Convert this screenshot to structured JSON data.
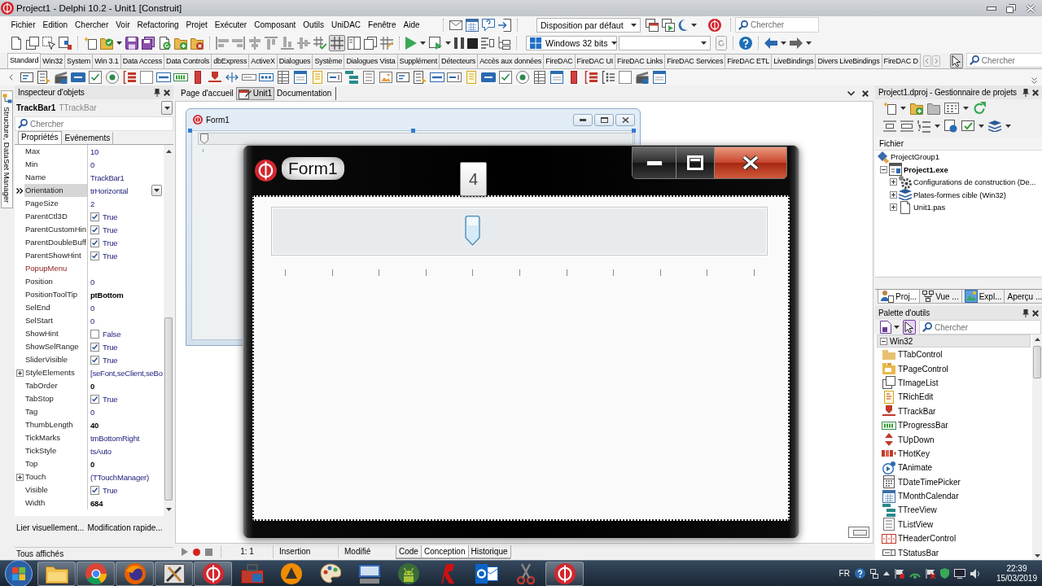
{
  "title_bar": {
    "title": "Project1 - Delphi 10.2 - Unit1 [Construit]"
  },
  "menu_bar": {
    "items": [
      "Fichier",
      "Edition",
      "Chercher",
      "Voir",
      "Refactoring",
      "Projet",
      "Exécuter",
      "Composant",
      "Outils",
      "UniDAC",
      "Fenêtre",
      "Aide"
    ],
    "layout": {
      "value": "Disposition par défaut"
    },
    "search": {
      "placeholder": "Chercher"
    }
  },
  "toolbar": {
    "grid_button": {
      "on": true
    },
    "platform": {
      "value": "Windows 32 bits"
    }
  },
  "component_palette": {
    "tabs": [
      {
        "label": "Standard",
        "selected": true
      },
      {
        "label": "Win32",
        "selected": false
      },
      {
        "label": "System",
        "selected": false
      },
      {
        "label": "Win 3.1",
        "selected": false
      },
      {
        "label": "Data Access",
        "selected": false
      },
      {
        "label": "Data Controls",
        "selected": false
      },
      {
        "label": "dbExpress",
        "selected": false
      },
      {
        "label": "ActiveX",
        "selected": false
      },
      {
        "label": "Dialogues",
        "selected": false
      },
      {
        "label": "Système",
        "selected": false
      },
      {
        "label": "Dialogues Vista",
        "selected": false
      },
      {
        "label": "Supplément",
        "selected": false
      },
      {
        "label": "Détecteurs",
        "selected": false
      },
      {
        "label": "Accès aux données",
        "selected": false
      },
      {
        "label": "FireDAC",
        "selected": false
      },
      {
        "label": "FireDAC UI",
        "selected": false
      },
      {
        "label": "FireDAC Links",
        "selected": false
      },
      {
        "label": "FireDAC Services",
        "selected": false
      },
      {
        "label": "FireDAC ETL",
        "selected": false
      },
      {
        "label": "LiveBindings",
        "selected": false
      },
      {
        "label": "Divers LiveBindings",
        "selected": false
      },
      {
        "label": "FireDAC D",
        "selected": false
      }
    ],
    "pointer_button": {
      "on": true
    },
    "search": {
      "placeholder": "Chercher"
    }
  },
  "side_tab": {
    "label": "Structure, DataSet Manager"
  },
  "object_inspector": {
    "title": "Inspecteur d'objets",
    "component": {
      "name": "TrackBar1",
      "type": "TTrackBar"
    },
    "search": {
      "placeholder": "Chercher"
    },
    "tabs": [
      {
        "label": "Propriétés",
        "selected": true
      },
      {
        "label": "Evénements",
        "selected": false
      }
    ],
    "properties": [
      {
        "name": "Max",
        "value": "10",
        "kind": "text",
        "selected": false,
        "non_default": false
      },
      {
        "name": "Min",
        "value": "0",
        "kind": "text",
        "selected": false,
        "non_default": false
      },
      {
        "name": "Name",
        "value": "TrackBar1",
        "kind": "text",
        "selected": false,
        "non_default": false
      },
      {
        "name": "Orientation",
        "value": "trHorizontal",
        "kind": "text",
        "selected": true,
        "non_default": false
      },
      {
        "name": "PageSize",
        "value": "2",
        "kind": "text",
        "selected": false,
        "non_default": false
      },
      {
        "name": "ParentCtl3D",
        "value": "True",
        "kind": "check",
        "checked": true,
        "selected": false,
        "non_default": false
      },
      {
        "name": "ParentCustomHin",
        "value": "True",
        "kind": "check",
        "checked": true,
        "selected": false,
        "non_default": false
      },
      {
        "name": "ParentDoubleBuff",
        "value": "True",
        "kind": "check",
        "checked": true,
        "selected": false,
        "non_default": false
      },
      {
        "name": "ParentShowHint",
        "value": "True",
        "kind": "check",
        "checked": true,
        "selected": false,
        "non_default": false
      },
      {
        "name": "PopupMenu",
        "kind": "link",
        "selected": false
      },
      {
        "name": "Position",
        "value": "0",
        "kind": "text",
        "selected": false,
        "non_default": false
      },
      {
        "name": "PositionToolTip",
        "value": "ptBottom",
        "kind": "text",
        "selected": false,
        "non_default": true
      },
      {
        "name": "SelEnd",
        "value": "0",
        "kind": "text",
        "selected": false,
        "non_default": false
      },
      {
        "name": "SelStart",
        "value": "0",
        "kind": "text",
        "selected": false,
        "non_default": false
      },
      {
        "name": "ShowHint",
        "value": "False",
        "kind": "check",
        "checked": false,
        "selected": false,
        "non_default": false
      },
      {
        "name": "ShowSelRange",
        "value": "True",
        "kind": "check",
        "checked": true,
        "selected": false,
        "non_default": false
      },
      {
        "name": "SliderVisible",
        "value": "True",
        "kind": "check",
        "checked": true,
        "selected": false,
        "non_default": false
      },
      {
        "name": "StyleElements",
        "value": "[seFont,seClient,seBo",
        "kind": "group",
        "expanded": false,
        "selected": false,
        "non_default": false
      },
      {
        "name": "TabOrder",
        "value": "0",
        "kind": "text",
        "selected": false,
        "non_default": true
      },
      {
        "name": "TabStop",
        "value": "True",
        "kind": "check",
        "checked": true,
        "selected": false,
        "non_default": false
      },
      {
        "name": "Tag",
        "value": "0",
        "kind": "text",
        "selected": false,
        "non_default": false
      },
      {
        "name": "ThumbLength",
        "value": "40",
        "kind": "text",
        "selected": false,
        "non_default": true
      },
      {
        "name": "TickMarks",
        "value": "tmBottomRight",
        "kind": "text",
        "selected": false,
        "non_default": false
      },
      {
        "name": "TickStyle",
        "value": "tsAuto",
        "kind": "text",
        "selected": false,
        "non_default": false
      },
      {
        "name": "Top",
        "value": "0",
        "kind": "text",
        "selected": false,
        "non_default": true
      },
      {
        "name": "Touch",
        "value": "(TTouchManager)",
        "kind": "group",
        "expanded": false,
        "selected": false,
        "non_default": false
      },
      {
        "name": "Visible",
        "value": "True",
        "kind": "check",
        "checked": true,
        "selected": false,
        "non_default": false
      },
      {
        "name": "Width",
        "value": "684",
        "kind": "text",
        "selected": false,
        "non_default": true
      }
    ],
    "links": [
      "Lier visuellement...",
      "Modification rapide..."
    ],
    "filter": "Tous affichés"
  },
  "editor": {
    "tabs": [
      {
        "label": "Page d'accueil",
        "selected": false
      },
      {
        "label": "Unit1",
        "selected": true
      },
      {
        "label": "Documentation",
        "selected": false
      }
    ],
    "design_form": {
      "title": "Form1",
      "trackbar": {
        "level": 0
      }
    },
    "running_form": {
      "title": "Form1",
      "tooltip": "4",
      "trackbar": {
        "level": 0.4
      }
    },
    "status": {
      "cursor": "1: 1",
      "mode": "Insertion",
      "state": "Modifié",
      "views": [
        {
          "label": "Code",
          "selected": false
        },
        {
          "label": "Conception",
          "selected": true
        },
        {
          "label": "Historique",
          "selected": false
        }
      ]
    }
  },
  "project_manager": {
    "title": "Project1.dproj - Gestionnaire de projets",
    "column": "Fichier",
    "tree": [
      {
        "label": "ProjectGroup1",
        "children": [
          {
            "label": "Project1.exe",
            "active": true,
            "expanded": true,
            "children": [
              {
                "label": "Configurations de construction (De...",
                "expanded": false
              },
              {
                "label": "Plates-formes cible (Win32)",
                "expanded": false
              },
              {
                "label": "Unit1.pas",
                "expanded": false
              }
            ]
          }
        ]
      }
    ],
    "tabs": [
      {
        "label": "Proj...",
        "selected": true
      },
      {
        "label": "Vue ...",
        "selected": false
      },
      {
        "label": "Expl...",
        "selected": false
      },
      {
        "label": "Aperçu ...",
        "selected": false
      }
    ]
  },
  "tool_palette": {
    "title": "Palette d'outils",
    "pointer_button": {
      "on": true
    },
    "search": {
      "placeholder": "Chercher"
    },
    "category": {
      "label": "Win32",
      "expanded": true
    },
    "items": [
      "TTabControl",
      "TPageControl",
      "TImageList",
      "TRichEdit",
      "TTrackBar",
      "TProgressBar",
      "TUpDown",
      "THotKey",
      "TAnimate",
      "TDateTimePicker",
      "TMonthCalendar",
      "TTreeView",
      "TListView",
      "THeaderControl",
      "TStatusBar"
    ]
  },
  "taskbar": {
    "apps": [
      {
        "running": true
      },
      {
        "running": true
      },
      {
        "running": true
      },
      {
        "running": true
      },
      {
        "running": true
      },
      {
        "running": false
      },
      {
        "running": false
      },
      {
        "running": false
      },
      {
        "running": false
      },
      {
        "running": false
      },
      {
        "running": false
      },
      {
        "running": false
      },
      {
        "running": false
      },
      {
        "running": true
      }
    ],
    "language": "FR",
    "time": "22:39",
    "date": "15/03/2019"
  }
}
